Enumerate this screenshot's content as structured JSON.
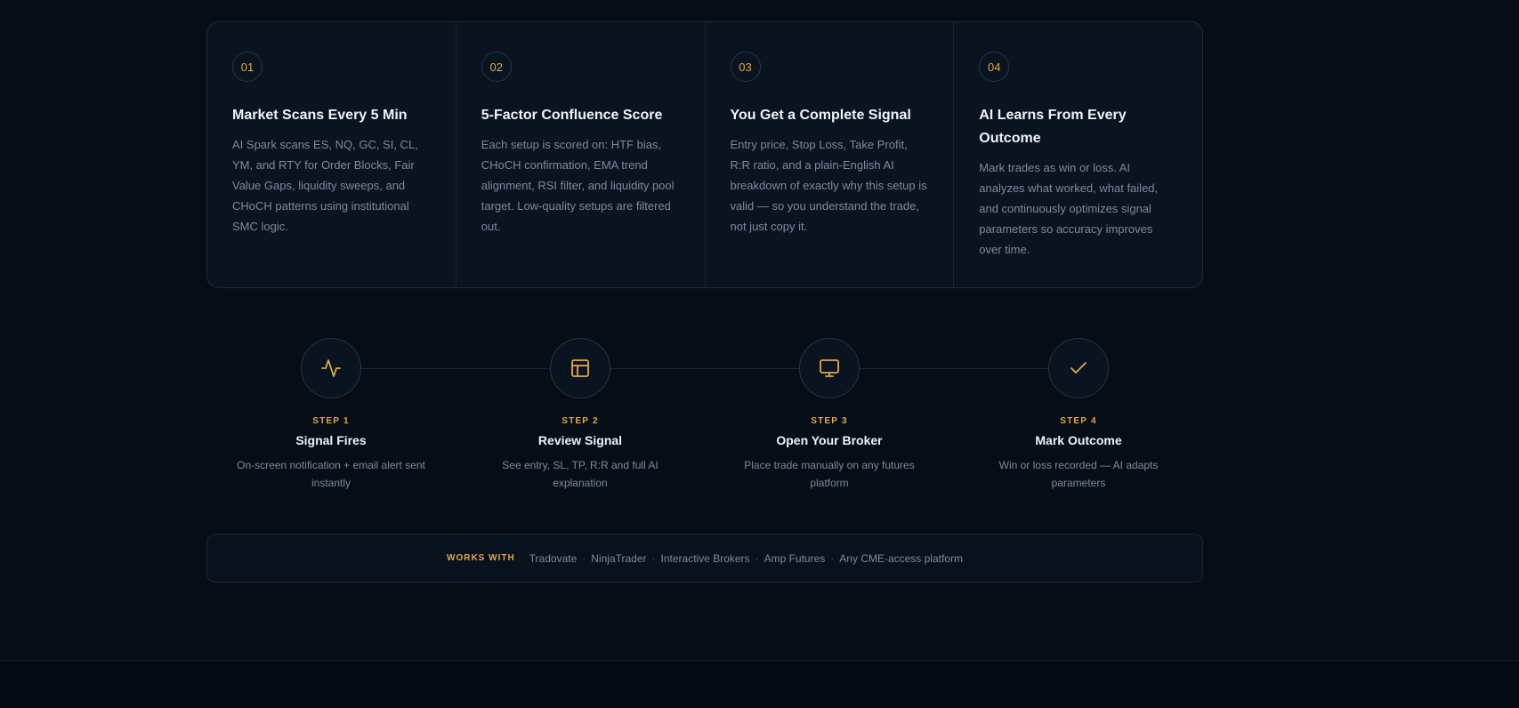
{
  "features": [
    {
      "num": "01",
      "title": "Market Scans Every 5 Min",
      "desc": "AI Spark scans ES, NQ, GC, SI, CL, YM, and RTY for Order Blocks, Fair Value Gaps, liquidity sweeps, and CHoCH patterns using institutional SMC logic."
    },
    {
      "num": "02",
      "title": "5-Factor Confluence Score",
      "desc": "Each setup is scored on: HTF bias, CHoCH confirmation, EMA trend alignment, RSI filter, and liquidity pool target. Low-quality setups are filtered out."
    },
    {
      "num": "03",
      "title": "You Get a Complete Signal",
      "desc": "Entry price, Stop Loss, Take Profit, R:R ratio, and a plain-English AI breakdown of exactly why this setup is valid — so you understand the trade, not just copy it."
    },
    {
      "num": "04",
      "title": "AI Learns From Every Outcome",
      "desc": "Mark trades as win or loss. AI analyzes what worked, what failed, and continuously optimizes signal parameters so accuracy improves over time."
    }
  ],
  "steps": [
    {
      "label": "STEP 1",
      "title": "Signal Fires",
      "desc": "On-screen notification + email alert sent instantly",
      "icon": "activity-icon"
    },
    {
      "label": "STEP 2",
      "title": "Review Signal",
      "desc": "See entry, SL, TP, R:R and full AI explanation",
      "icon": "layout-icon"
    },
    {
      "label": "STEP 3",
      "title": "Open Your Broker",
      "desc": "Place trade manually on any futures platform",
      "icon": "monitor-icon"
    },
    {
      "label": "STEP 4",
      "title": "Mark Outcome",
      "desc": "Win or loss recorded — AI adapts parameters",
      "icon": "check-icon"
    }
  ],
  "works_with": {
    "label": "WORKS WITH",
    "items": [
      "Tradovate",
      "NinjaTrader",
      "Interactive Brokers",
      "Amp Futures",
      "Any CME-access platform"
    ],
    "separator": "·"
  },
  "colors": {
    "accent": "#e0a84f",
    "background": "#060d17",
    "card": "#0a1320",
    "muted_text": "#7d8a9c"
  }
}
